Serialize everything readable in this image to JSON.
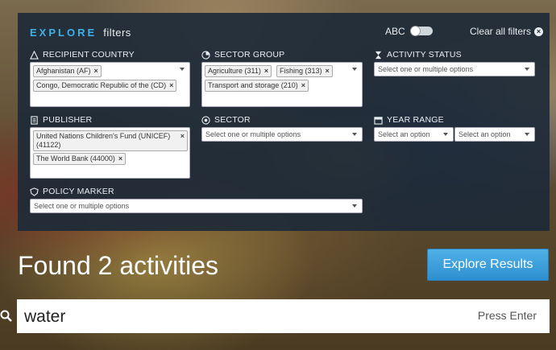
{
  "header": {
    "explore": "EXPLORE",
    "filters": "filters",
    "abc": "ABC",
    "clear_all": "Clear all filters"
  },
  "filters": {
    "recipient_country": {
      "label": "RECIPIENT COUNTRY",
      "chips": [
        "Afghanistan (AF)",
        "Congo, Democratic Republic of the (CD)"
      ]
    },
    "sector_group": {
      "label": "SECTOR GROUP",
      "chips": [
        "Agriculture (311)",
        "Fishing (313)",
        "Transport and storage (210)"
      ]
    },
    "activity_status": {
      "label": "ACTIVITY STATUS",
      "placeholder": "Select one or multiple options"
    },
    "publisher": {
      "label": "PUBLISHER",
      "chips": [
        "United Nations Children's Fund (UNICEF) (41122)",
        "The World Bank (44000)"
      ]
    },
    "sector": {
      "label": "SECTOR",
      "placeholder": "Select one or multiple options"
    },
    "year_range": {
      "label": "YEAR RANGE",
      "from_placeholder": "Select an option",
      "to_placeholder": "Select an option"
    },
    "policy_marker": {
      "label": "POLICY MARKER",
      "placeholder": "Select one or multiple options"
    }
  },
  "results": {
    "found_text": "Found 2 activities",
    "explore_button": "Explore Results"
  },
  "search": {
    "value": "water",
    "hint": "Press Enter"
  },
  "colors": {
    "accent": "#3fb0e8",
    "panel": "#1d2a38",
    "button": "#2d8fd0"
  }
}
